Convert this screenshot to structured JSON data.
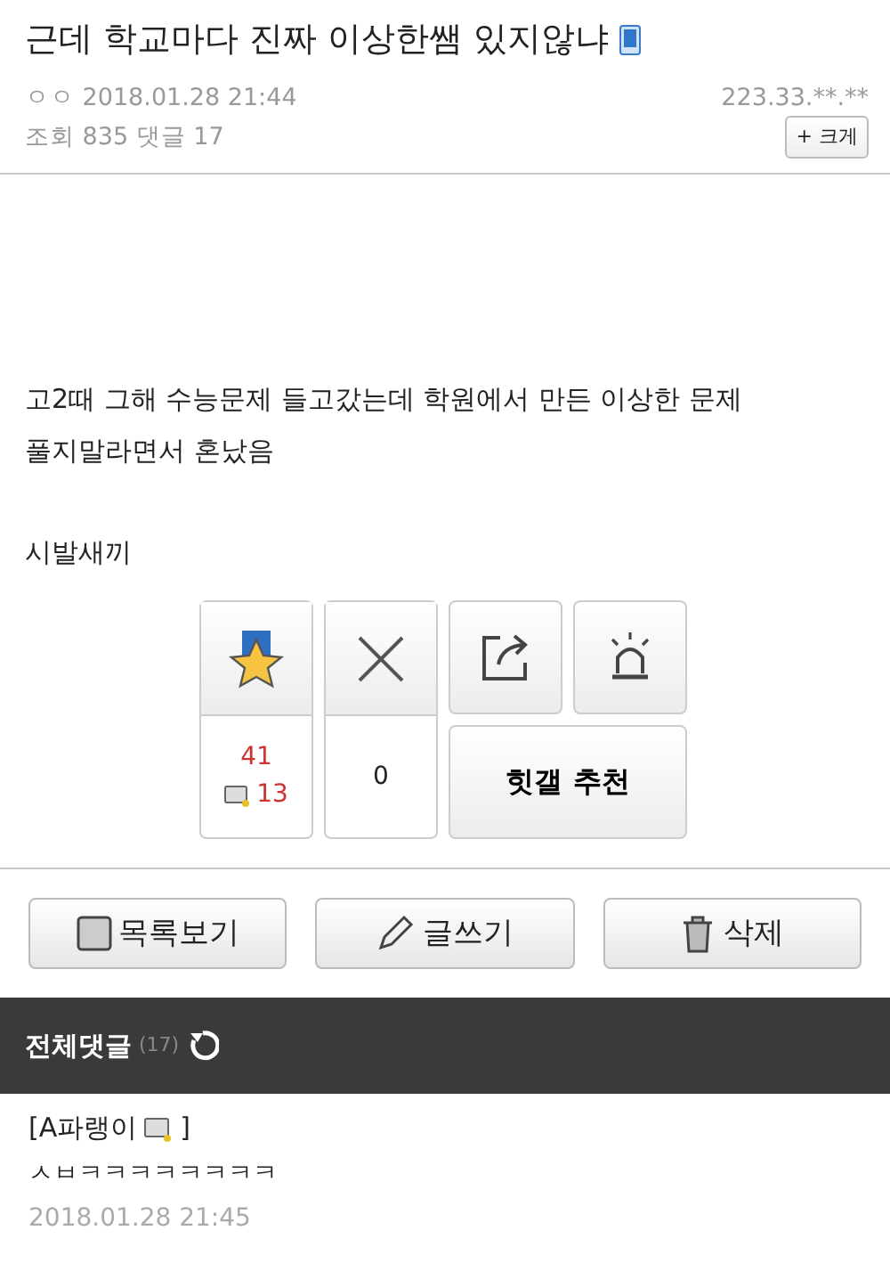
{
  "post": {
    "title": "근데 학교마다 진짜 이상한쌤 있지않냐",
    "author": "ㅇㅇ",
    "date": "2018.01.28 21:44",
    "ip": "223.33.**.**",
    "views_label": "조회",
    "views": "835",
    "comments_label": "댓글",
    "comments": "17",
    "zoom_button": "+ 크게"
  },
  "body": [
    [
      "고2때 그해 수능문제 들고갔는데 학원에서 만든 이상한 문제",
      "풀지말라면서 혼났음"
    ],
    [
      "시발새끼"
    ]
  ],
  "votes": {
    "up": "41",
    "up_fixed": "13",
    "down": "0",
    "recommend": "힛갤 추천"
  },
  "actions": [
    {
      "kind": "list",
      "label": "목록보기"
    },
    {
      "kind": "write",
      "label": "글쓰기"
    },
    {
      "kind": "delete",
      "label": "삭제"
    }
  ],
  "comments_header": {
    "title": "전체댓글",
    "count": "(17)"
  },
  "comments": [
    {
      "author": "[A파랭이",
      "author_end": "]",
      "text": "ㅅㅂㅋㅋㅋㅋㅋㅋㅋㅋ",
      "date": "2018.01.28 21:45"
    }
  ]
}
